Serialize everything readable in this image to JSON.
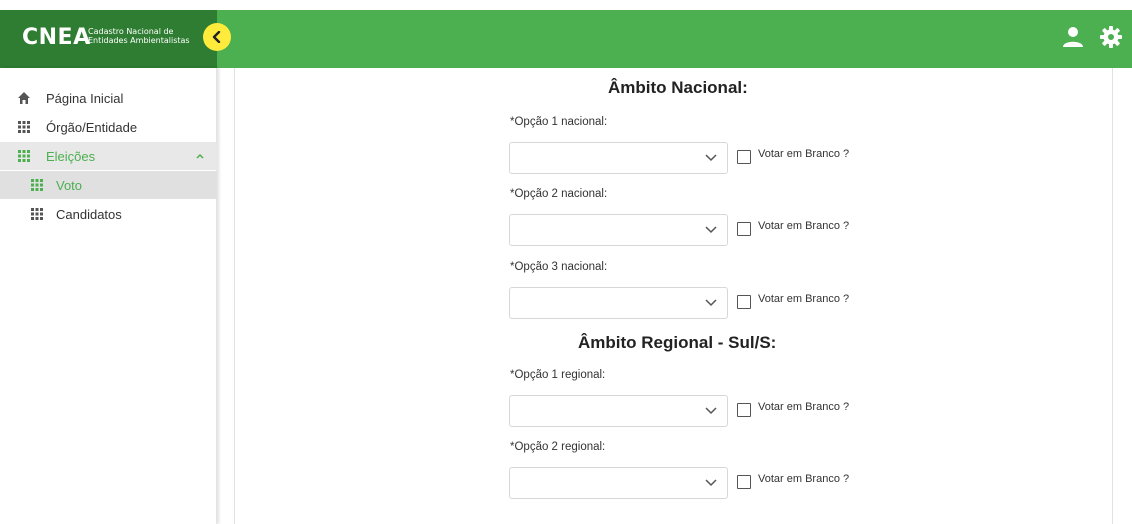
{
  "brand": {
    "logo_text": "CNEA",
    "subtitle_line1": "Cadastro Nacional de",
    "subtitle_line2": "Entidades Ambientalistas",
    "accent_dark": "#2e7d32",
    "accent": "#4caf50",
    "toggle_color": "#ffeb3b"
  },
  "topbar": {
    "icons": [
      "chevron-left-icon",
      "user-icon",
      "gear-icon"
    ]
  },
  "sidebar": {
    "items": [
      {
        "label": "Página Inicial",
        "icon": "home-icon"
      },
      {
        "label": "Órgão/Entidade",
        "icon": "grid-icon"
      },
      {
        "label": "Eleições",
        "icon": "grid-icon",
        "expanded": true
      },
      {
        "label": "Voto",
        "icon": "grid-icon",
        "active": true
      },
      {
        "label": "Candidatos",
        "icon": "grid-icon"
      }
    ]
  },
  "form": {
    "nacional_title": "Âmbito Nacional:",
    "regional_title": "Âmbito Regional - Sul/S:",
    "blank_label": "Votar em Branco ?",
    "nacional_fields": [
      {
        "label": "*Opção 1 nacional:",
        "value": ""
      },
      {
        "label": "*Opção 2 nacional:",
        "value": ""
      },
      {
        "label": "*Opção 3 nacional:",
        "value": ""
      }
    ],
    "regional_fields": [
      {
        "label": "*Opção 1 regional:",
        "value": ""
      },
      {
        "label": "*Opção 2 regional:",
        "value": ""
      }
    ]
  }
}
